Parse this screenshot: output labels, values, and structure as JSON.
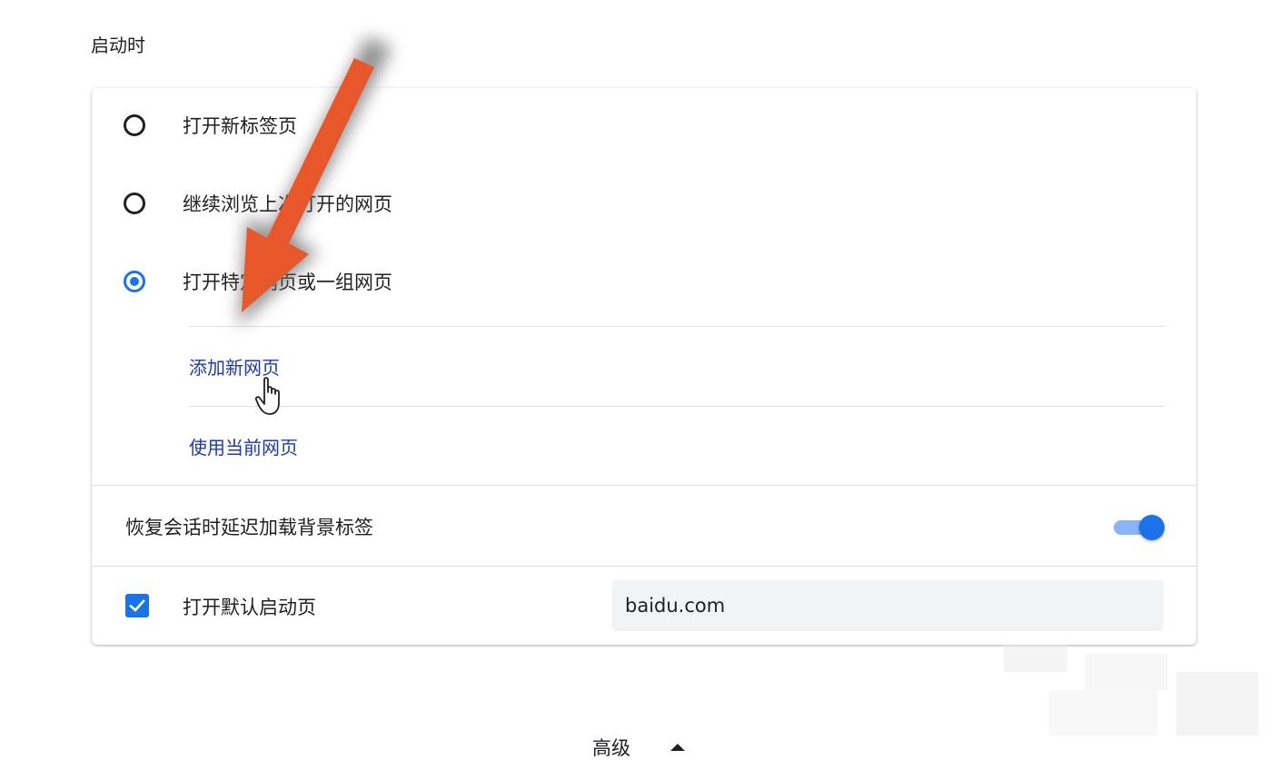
{
  "section": {
    "title": "启动时"
  },
  "startup_options": [
    {
      "label": "打开新标签页",
      "selected": false
    },
    {
      "label": "继续浏览上次打开的网页",
      "selected": false
    },
    {
      "label": "打开特定网页或一组网页",
      "selected": true
    }
  ],
  "links": {
    "add_page": "添加新网页",
    "use_current": "使用当前网页"
  },
  "lazy_load": {
    "label": "恢复会话时延迟加载背景标签",
    "enabled": true
  },
  "default_startup": {
    "label": "打开默认启动页",
    "checked": true,
    "value": "baidu.com"
  },
  "footer": {
    "advanced_label": "高级"
  },
  "colors": {
    "accent": "#1a73e8",
    "link": "#1a3ab8",
    "annotation_arrow": "#e8572a"
  },
  "icons": {
    "cursor": "hand-pointer-icon",
    "expand": "caret-up-icon",
    "annotation": "arrow-annotation-icon"
  }
}
